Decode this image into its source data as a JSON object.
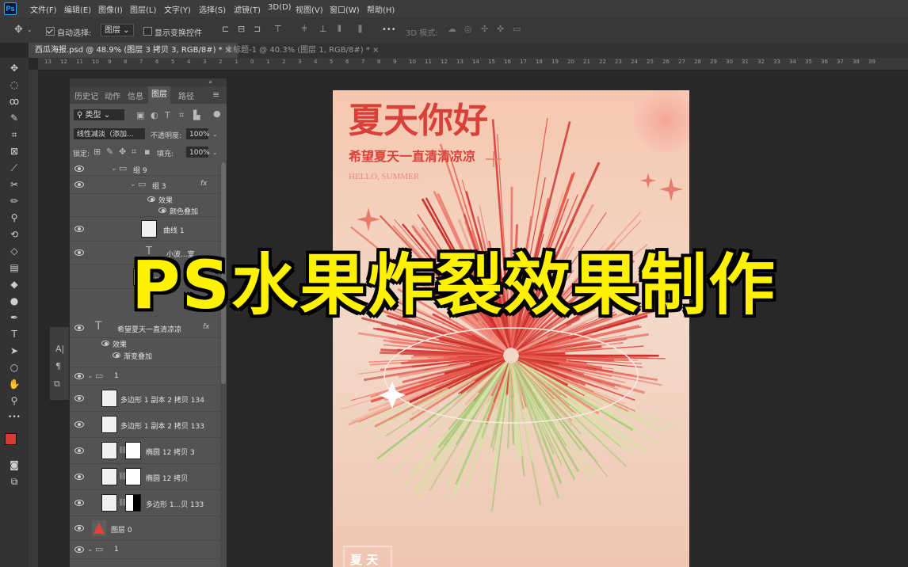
{
  "menu": [
    "文件(F)",
    "编辑(E)",
    "图像(I)",
    "图层(L)",
    "文字(Y)",
    "选择(S)",
    "滤镜(T)",
    "3D(D)",
    "视图(V)",
    "窗口(W)",
    "帮助(H)"
  ],
  "options": {
    "auto_select_label": "自动选择:",
    "auto_select_value": "图层",
    "show_transform_label": "显示变换控件",
    "more": "•••",
    "mode_3d": "3D 模式:"
  },
  "tabs": [
    {
      "label": "西瓜海报.psd @ 48.9% (图层 3 拷贝 3, RGB/8#) *",
      "close": "×"
    },
    {
      "label": "未标题-1 @ 40.3% (图层 1, RGB/8#) *",
      "close": "×"
    }
  ],
  "ruler": [
    "13",
    "12",
    "11",
    "10",
    "9",
    "8",
    "7",
    "6",
    "5",
    "4",
    "3",
    "2",
    "1",
    "0",
    "1",
    "2",
    "3",
    "4",
    "5",
    "6",
    "7",
    "8",
    "9",
    "10",
    "11",
    "12",
    "13",
    "14",
    "15",
    "16",
    "17",
    "18",
    "19",
    "20",
    "21",
    "22",
    "23",
    "24",
    "25",
    "26",
    "27",
    "28",
    "29",
    "30",
    "31",
    "32",
    "33",
    "34",
    "35",
    "36",
    "37",
    "38",
    "39"
  ],
  "panel": {
    "tabs": [
      "历史记",
      "动作",
      "信息",
      "图层",
      "路径"
    ],
    "filter_kind": "类型",
    "blend_mode": "线性减淡（添加...",
    "opacity_label": "不透明度:",
    "opacity_value": "100%",
    "lock_label": "锁定:",
    "fill_label": "填充:",
    "fill_value": "100%",
    "fx": "fx"
  },
  "layers": [
    {
      "name": "组 9",
      "type": "group"
    },
    {
      "name": "组 3",
      "type": "group",
      "fx": true
    },
    {
      "name": "效果",
      "type": "effect"
    },
    {
      "name": "颜色叠加",
      "type": "effect"
    },
    {
      "name": "曲线 1",
      "type": "adjust"
    },
    {
      "name": "小波...室",
      "type": "text"
    },
    {
      "name": "...1",
      "type": "layer"
    },
    {
      "name": "希望夏天一直清凉凉",
      "type": "text",
      "fx": true
    },
    {
      "name": "效果",
      "type": "effect"
    },
    {
      "name": "渐变叠加",
      "type": "effect"
    },
    {
      "name": "1",
      "type": "group"
    },
    {
      "name": "多边形 1 副本 2 拷贝 134",
      "type": "shape"
    },
    {
      "name": "多边形 1 副本 2 拷贝 133",
      "type": "shape"
    },
    {
      "name": "椭圆 12 拷贝 3",
      "type": "masked"
    },
    {
      "name": "椭圆 12 拷贝",
      "type": "masked"
    },
    {
      "name": "多边形 1...贝 133",
      "type": "masked"
    },
    {
      "name": "图层 0",
      "type": "image"
    },
    {
      "name": "1",
      "type": "group"
    }
  ],
  "poster": {
    "title": "夏天你好",
    "subtitle": "希望夏天一直清清凉凉",
    "english": "HELLO, SUMMER",
    "bottom": "夏 天"
  },
  "overlay_title": "PS水果炸裂效果制作",
  "colors": {
    "foreground": "#d83a35",
    "background": "#ffffff",
    "poster_red": "#d8413a",
    "overlay_yellow": "#fff200"
  }
}
